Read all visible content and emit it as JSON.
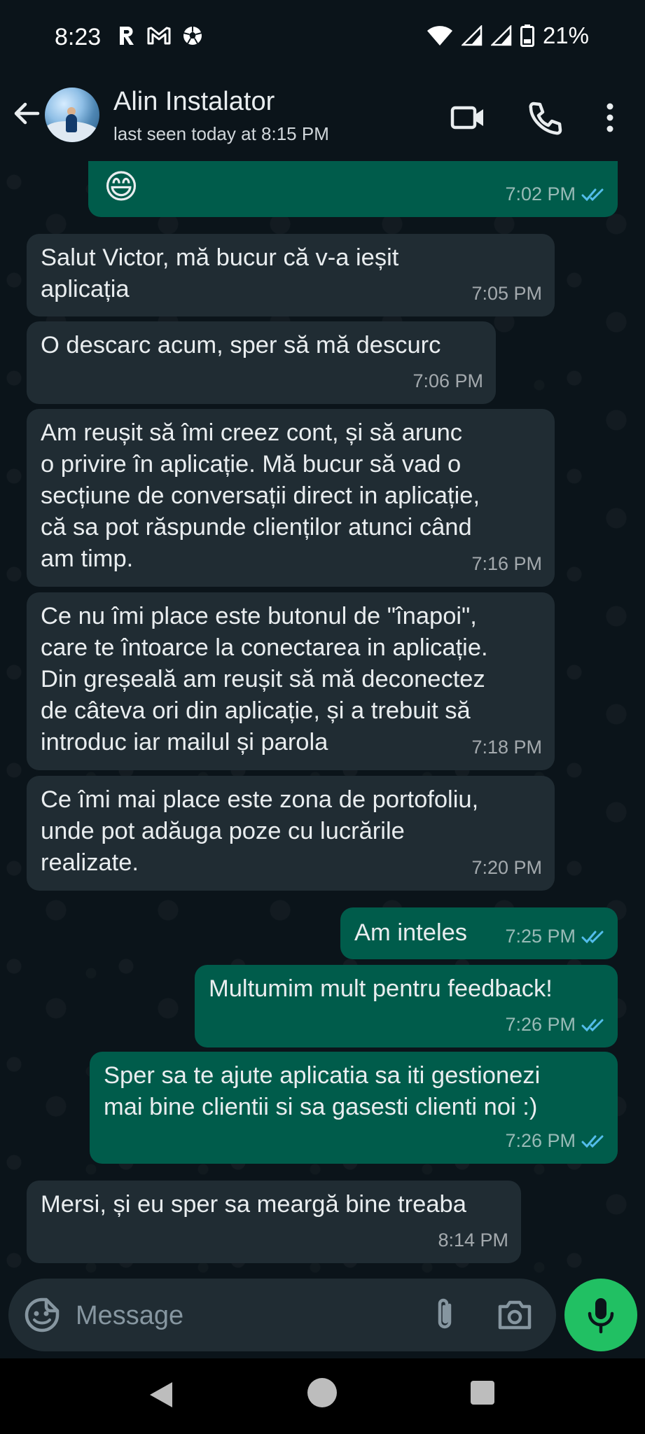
{
  "status_bar": {
    "time": "8:23",
    "app_icons": [
      "r-app-icon",
      "gmail-icon",
      "football-icon"
    ],
    "battery": "21%"
  },
  "header": {
    "contact_name": "Alin Instalator",
    "last_seen": "last seen today at 8:15 PM",
    "icons": [
      "back-arrow-icon",
      "video-call-icon",
      "phone-icon",
      "more-vert-icon"
    ]
  },
  "messages": [
    {
      "direction": "out",
      "text": "😄",
      "time": "7:02 PM",
      "read": true
    },
    {
      "direction": "in",
      "text": "Salut Victor, mă bucur că v-a ieșit\naplicația",
      "time": "7:05 PM"
    },
    {
      "direction": "in",
      "text": "O descarc acum, sper să mă descurc",
      "time": "7:06 PM"
    },
    {
      "direction": "in",
      "text": "Am reușit să îmi creez cont, și să arunc\no privire în aplicație. Mă bucur să vad o\nsecțiune de conversații direct in aplicație,\ncă sa pot răspunde clienților atunci când\nam timp.",
      "time": "7:16 PM"
    },
    {
      "direction": "in",
      "text": "Ce nu îmi place este butonul de \"înapoi\",\ncare te întoarce la conectarea in aplicație.\nDin greșeală am reușit să mă deconectez\nde câteva ori din aplicație, și a trebuit să\nintroduc iar mailul și parola",
      "time": "7:18 PM"
    },
    {
      "direction": "in",
      "text": "Ce îmi mai place este zona de portofoliu,\nunde pot adăuga poze cu lucrările\nrealizate.",
      "time": "7:20 PM"
    },
    {
      "direction": "out",
      "text": "Am inteles",
      "time": "7:25 PM",
      "read": true
    },
    {
      "direction": "out",
      "text": "Multumim mult pentru feedback!",
      "time": "7:26 PM",
      "read": true
    },
    {
      "direction": "out",
      "text": "Sper sa te ajute aplicatia sa iti gestionezi\nmai bine clientii si sa gasesti clienti noi :)",
      "time": "7:26 PM",
      "read": true
    },
    {
      "direction": "in",
      "text": "Mersi, și eu sper sa meargă bine treaba",
      "time": "8:14 PM"
    }
  ],
  "composer": {
    "placeholder": "Message"
  },
  "colors": {
    "background": "#0b141a",
    "incoming_bubble": "#202c33",
    "outgoing_bubble": "#005c4b",
    "read_ticks": "#53bdeb",
    "mic_button": "#21c063"
  }
}
